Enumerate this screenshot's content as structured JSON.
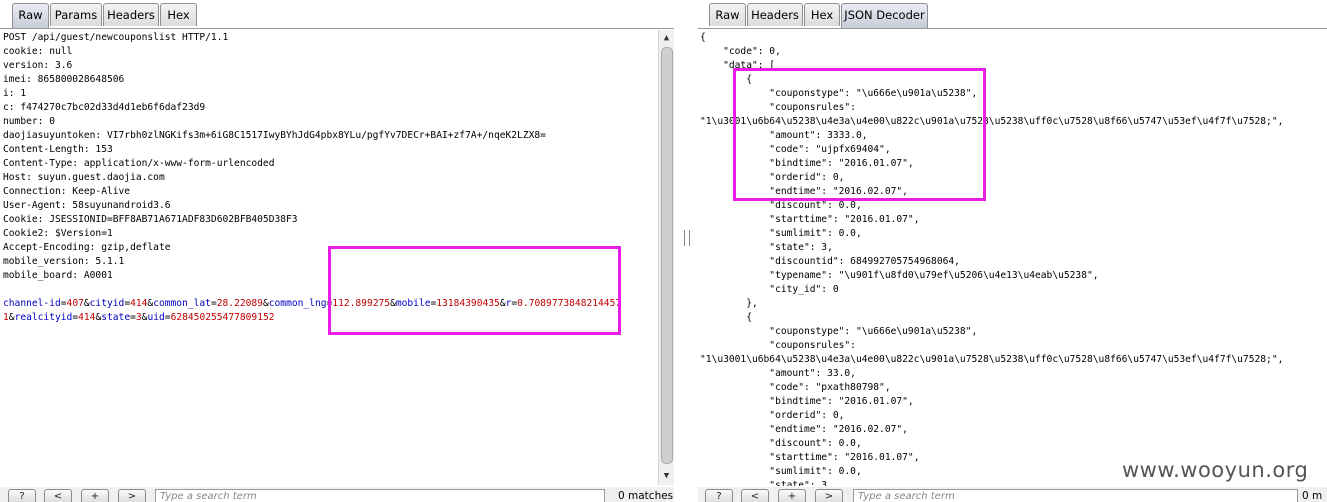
{
  "left": {
    "tabs": [
      "Raw",
      "Params",
      "Headers",
      "Hex"
    ],
    "active_tab": "Raw",
    "request_lines": [
      "POST /api/guest/newcouponslist HTTP/1.1",
      "cookie: null",
      "version: 3.6",
      "imei: 865800028648506",
      "i: 1",
      "c: f474270c7bc02d33d4d1eb6f6daf23d9",
      "number: 0",
      "daojiasuyuntoken: VI7rbh0zlNGKifs3m+6iG8C1517IwyBYhJdG4pbx8YLu/pgfYv7DECr+BAI+zf7A+/nqeK2LZX8=",
      "Content-Length: 153",
      "Content-Type: application/x-www-form-urlencoded",
      "Host: suyun.guest.daojia.com",
      "Connection: Keep-Alive",
      "User-Agent: 58suyunandroid3.6",
      "Cookie: JSESSIONID=BFF8AB71A671ADF83D602BFB405D38F3",
      "Cookie2: $Version=1",
      "Accept-Encoding: gzip,deflate",
      "mobile_version: 5.1.1",
      "mobile_board: A0001"
    ],
    "body_line1": [
      {
        "t": "channel-id",
        "c": "blue"
      },
      {
        "t": "=",
        "c": "plain"
      },
      {
        "t": "407",
        "c": "red"
      },
      {
        "t": "&",
        "c": "plain"
      },
      {
        "t": "cityid",
        "c": "blue"
      },
      {
        "t": "=",
        "c": "plain"
      },
      {
        "t": "414",
        "c": "red"
      },
      {
        "t": "&",
        "c": "plain"
      },
      {
        "t": "common_lat",
        "c": "blue"
      },
      {
        "t": "=",
        "c": "plain"
      },
      {
        "t": "28.22089",
        "c": "red"
      },
      {
        "t": "&",
        "c": "plain"
      },
      {
        "t": "common_lng",
        "c": "blue"
      },
      {
        "t": "=",
        "c": "plain"
      },
      {
        "t": "112.899275",
        "c": "red"
      },
      {
        "t": "&",
        "c": "plain"
      },
      {
        "t": "mobile",
        "c": "blue"
      },
      {
        "t": "=",
        "c": "plain"
      },
      {
        "t": "13184390435",
        "c": "red"
      },
      {
        "t": "&",
        "c": "plain"
      },
      {
        "t": "r",
        "c": "blue"
      },
      {
        "t": "=",
        "c": "plain"
      },
      {
        "t": "0.7089773848214457",
        "c": "red"
      }
    ],
    "body_line2": [
      {
        "t": "1",
        "c": "red"
      },
      {
        "t": "&",
        "c": "plain"
      },
      {
        "t": "realcityid",
        "c": "blue"
      },
      {
        "t": "=",
        "c": "plain"
      },
      {
        "t": "414",
        "c": "red"
      },
      {
        "t": "&",
        "c": "plain"
      },
      {
        "t": "state",
        "c": "blue"
      },
      {
        "t": "=",
        "c": "plain"
      },
      {
        "t": "3",
        "c": "red"
      },
      {
        "t": "&",
        "c": "plain"
      },
      {
        "t": "uid",
        "c": "blue"
      },
      {
        "t": "=",
        "c": "plain"
      },
      {
        "t": "628450255477809152",
        "c": "red"
      }
    ],
    "toolbar": {
      "help": "?",
      "prev": "<",
      "add": "+",
      "next": ">",
      "search_placeholder": "Type a search term",
      "matches": "0 matches"
    }
  },
  "right": {
    "tabs": [
      "Raw",
      "Headers",
      "Hex",
      "JSON Decoder"
    ],
    "active_tab": "JSON Decoder",
    "json_lines": [
      "{",
      "    \"code\": 0,",
      "    \"data\": [",
      "        {",
      "            \"couponstype\": \"\\u666e\\u901a\\u5238\",",
      "            \"couponsrules\":",
      "\"1\\u3001\\u6b64\\u5238\\u4e3a\\u4e00\\u822c\\u901a\\u7528\\u5238\\uff0c\\u7528\\u8f66\\u5747\\u53ef\\u4f7f\\u7528;\",",
      "            \"amount\": 3333.0,",
      "            \"code\": \"ujpfx69404\",",
      "            \"bindtime\": \"2016.01.07\",",
      "            \"orderid\": 0,",
      "            \"endtime\": \"2016.02.07\",",
      "            \"discount\": 0.0,",
      "            \"starttime\": \"2016.01.07\",",
      "            \"sumlimit\": 0.0,",
      "            \"state\": 3,",
      "            \"discountid\": 684992705754968064,",
      "            \"typename\": \"\\u901f\\u8fd0\\u79ef\\u5206\\u4e13\\u4eab\\u5238\",",
      "            \"city_id\": 0",
      "        },",
      "        {",
      "            \"couponstype\": \"\\u666e\\u901a\\u5238\",",
      "            \"couponsrules\":",
      "\"1\\u3001\\u6b64\\u5238\\u4e3a\\u4e00\\u822c\\u901a\\u7528\\u5238\\uff0c\\u7528\\u8f66\\u5747\\u53ef\\u4f7f\\u7528;\",",
      "            \"amount\": 33.0,",
      "            \"code\": \"pxath80798\",",
      "            \"bindtime\": \"2016.01.07\",",
      "            \"orderid\": 0,",
      "            \"endtime\": \"2016.02.07\",",
      "            \"discount\": 0.0,",
      "            \"starttime\": \"2016.01.07\",",
      "            \"sumlimit\": 0.0,",
      "            \"state\": 3"
    ],
    "toolbar": {
      "help": "?",
      "prev": "<",
      "add": "+",
      "next": ">",
      "search_placeholder": "Type a search term",
      "matches": "0 m"
    }
  },
  "watermark": "www.wooyun.org",
  "colors": {
    "highlight": "#e81ee8",
    "param_name": "#0000c0",
    "param_value": "#c00000"
  }
}
